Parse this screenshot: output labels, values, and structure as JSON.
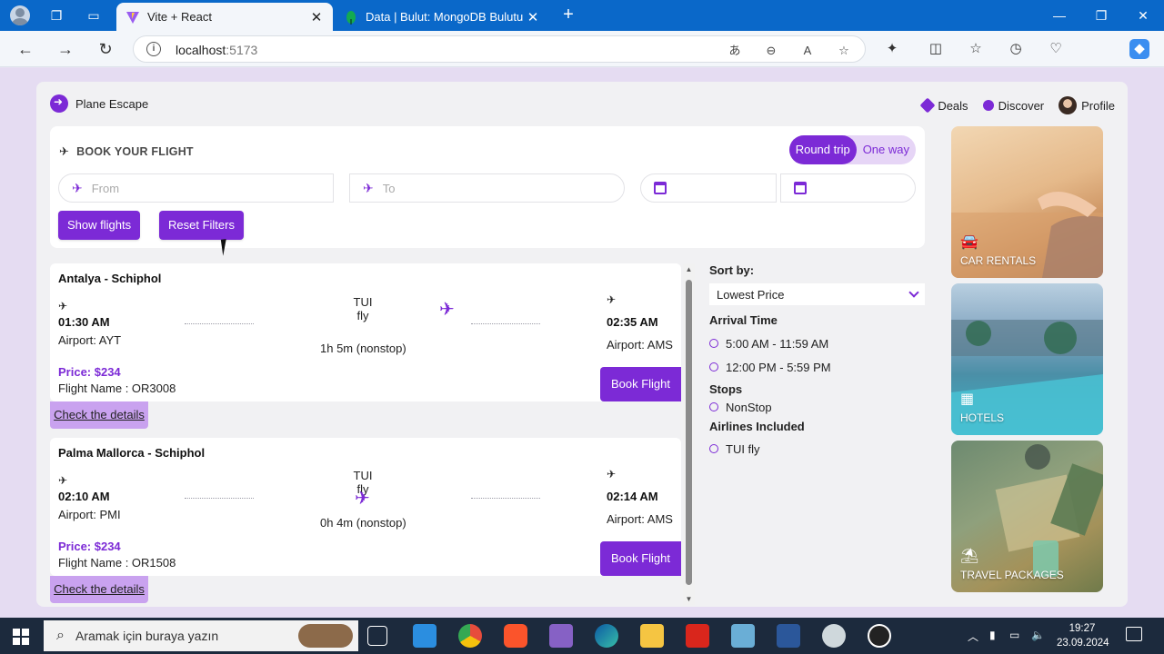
{
  "browser": {
    "tabs": [
      {
        "title": "Vite + React",
        "active": true
      },
      {
        "title": "Data | Bulut: MongoDB Bulutu",
        "active": false
      }
    ],
    "url_host": "localhost",
    "url_port": ":5173"
  },
  "app": {
    "brand": "Plane Escape",
    "nav": {
      "deals": "Deals",
      "discover": "Discover",
      "profile": "Profile"
    },
    "booking": {
      "title": "BOOK YOUR FLIGHT",
      "round_trip": "Round trip",
      "one_way": "One way",
      "from_placeholder": "From",
      "to_placeholder": "To",
      "show_flights": "Show flights",
      "reset_filters": "Reset Filters"
    },
    "flights": [
      {
        "route": "Antalya - Schiphol",
        "airline": "TUI fly",
        "dep_time": "01:30 AM",
        "dep_airport": "Airport: AYT",
        "arr_time": "02:35 AM",
        "arr_airport": "Airport: AMS",
        "duration": "1h 5m (nonstop)",
        "price": "Price: $234",
        "flight_name": "Flight Name : OR3008",
        "book": "Book Flight",
        "details": "Check the details"
      },
      {
        "route": "Palma Mallorca - Schiphol",
        "airline": "TUI fly",
        "dep_time": "02:10 AM",
        "dep_airport": "Airport: PMI",
        "arr_time": "02:14 AM",
        "arr_airport": "Airport: AMS",
        "duration": "0h 4m (nonstop)",
        "price": "Price: $234",
        "flight_name": "Flight Name : OR1508",
        "book": "Book Flight",
        "details": "Check the details"
      }
    ],
    "filters": {
      "sort_label": "Sort by:",
      "sort_value": "Lowest Price",
      "arrival_label": "Arrival Time",
      "arrival_options": [
        "5:00 AM - 11:59 AM",
        "12:00 PM - 5:59 PM"
      ],
      "stops_label": "Stops",
      "stops_options": [
        "NonStop"
      ],
      "airlines_label": "Airlines Included",
      "airlines_options": [
        "TUI fly"
      ]
    },
    "promos": [
      "CAR RENTALS",
      "HOTELS",
      "TRAVEL PACKAGES"
    ]
  },
  "taskbar": {
    "search_placeholder": "Aramak için buraya yazın",
    "time": "19:27",
    "date": "23.09.2024"
  },
  "colors": {
    "accent": "#7c2ad6",
    "accent_light": "#c9a2ef",
    "taskbar": "#1c2a3d",
    "tabstrip": "#0a68c9"
  }
}
